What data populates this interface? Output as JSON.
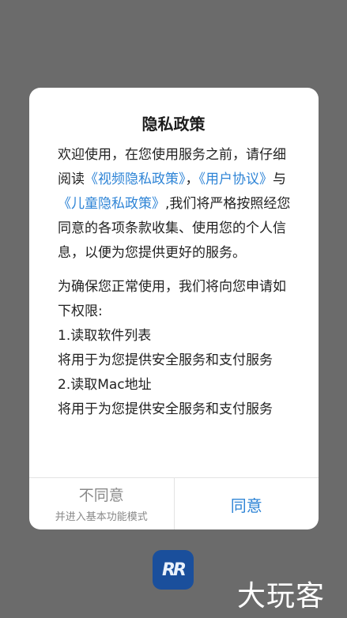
{
  "dialog": {
    "title": "隐私政策",
    "intro": {
      "part1": "欢迎使用，在您使用服务之前，请仔细阅读",
      "link_video_privacy": "《视频隐私政策》",
      "sep1": "，",
      "link_user_agreement": "《用户协议》",
      "sep2": "与",
      "link_child_privacy": "《儿童隐私政策》",
      "part2": ",我们将严格按照经您同意的各项条款收集、使用您的个人信息，以便为您提供更好的服务。"
    },
    "permissions_intro": "为确保您正常使用，我们将向您申请如下权限:",
    "permissions": [
      {
        "title": " 1.读取软件列表",
        "desc": " 将用于为您提供安全服务和支付服务"
      },
      {
        "title": " 2.读取Mac地址",
        "desc": " 将用于为您提供安全服务和支付服务"
      }
    ],
    "disagree_label": "不同意",
    "disagree_sublabel": "并进入基本功能模式",
    "agree_label": "同意"
  },
  "app_icon": {
    "icon": "app-logo-icon",
    "glyph": "RR"
  },
  "watermark": {
    "text": "大玩客"
  },
  "colors": {
    "backdrop": "#6b6b6b",
    "link": "#2e84d6",
    "app_icon_bg": "#1a4f9c"
  }
}
